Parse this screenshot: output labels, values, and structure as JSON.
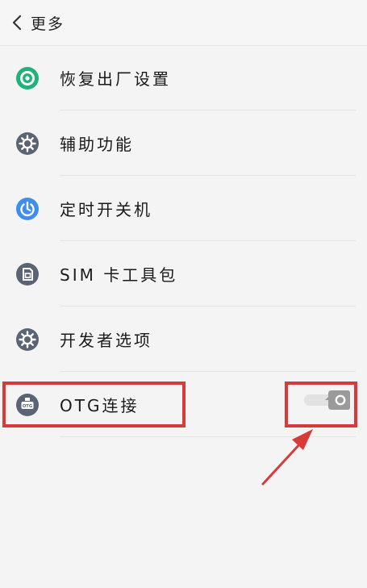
{
  "header": {
    "title": "更多"
  },
  "items": [
    {
      "label": "恢复出厂设置",
      "icon": "factory-reset-icon",
      "color": "#1fb37a"
    },
    {
      "label": "辅助功能",
      "icon": "accessibility-gear-icon",
      "color": "#5a6474"
    },
    {
      "label": "定时开关机",
      "icon": "timer-power-icon",
      "color": "#3d8ef0"
    },
    {
      "label": "SIM 卡工具包",
      "icon": "sim-card-icon",
      "color": "#5a6474"
    },
    {
      "label": "开发者选项",
      "icon": "developer-gear-icon",
      "color": "#5a6474"
    },
    {
      "label": "OTG连接",
      "icon": "otg-icon",
      "color": "#5a6474",
      "toggle": false
    }
  ],
  "colors": {
    "highlight": "#d83a3a"
  }
}
